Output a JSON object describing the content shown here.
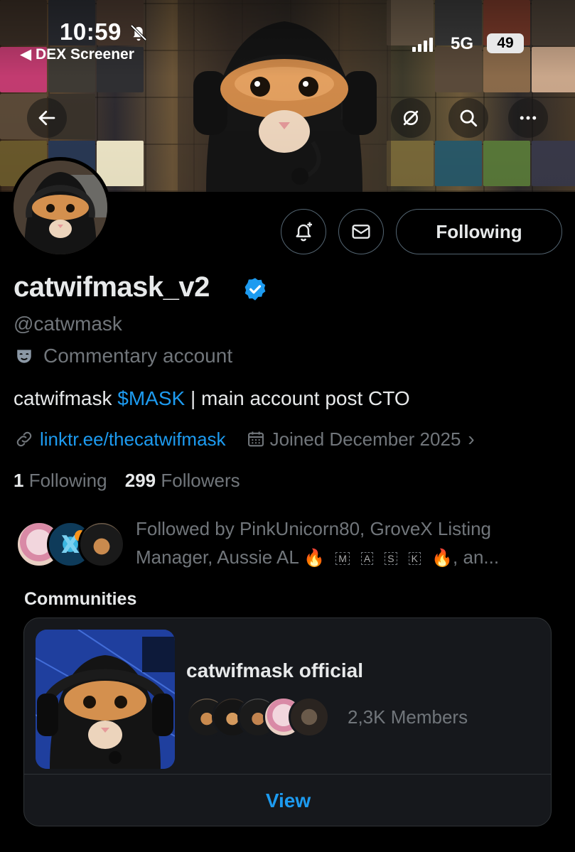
{
  "status_bar": {
    "time": "10:59",
    "back_app": "◀ DEX Screener",
    "network": "5G",
    "battery": "49"
  },
  "profile": {
    "display_name": "catwifmask_v2",
    "handle": "@catwmask",
    "label": "Commentary account",
    "bio_prefix": "catwifmask ",
    "bio_cashtag": "$MASK",
    "bio_suffix": " | main account post CTO",
    "link": "linktr.ee/thecatwifmask",
    "joined": "Joined December 2025",
    "following_count": "1",
    "following_label": "Following",
    "followers_count": "299",
    "followers_label": "Followers",
    "follow_button": "Following",
    "followed_by_line1": "Followed by PinkUnicorn80, GroveX Listing",
    "followed_by_line2_start": "Manager, Aussie AL",
    "followed_by_keys": [
      "M",
      "A",
      "S",
      "K"
    ],
    "followed_by_end": ", an..."
  },
  "communities": {
    "heading": "Communities",
    "name": "catwifmask official",
    "members": "2,3K Members",
    "view": "View"
  },
  "icons": {
    "back": "back-arrow-icon",
    "grok": "grok-icon",
    "search": "search-icon",
    "more": "more-icon",
    "notify": "notification-bell-plus-icon",
    "message": "envelope-icon",
    "verified": "verified-badge-icon",
    "commentary": "theater-mask-icon",
    "link": "link-icon",
    "calendar": "calendar-icon",
    "fire": "fire-emoji"
  },
  "colors": {
    "accent": "#1d9bf0",
    "muted": "#71767b",
    "text": "#e7e9ea",
    "background": "#000000"
  }
}
